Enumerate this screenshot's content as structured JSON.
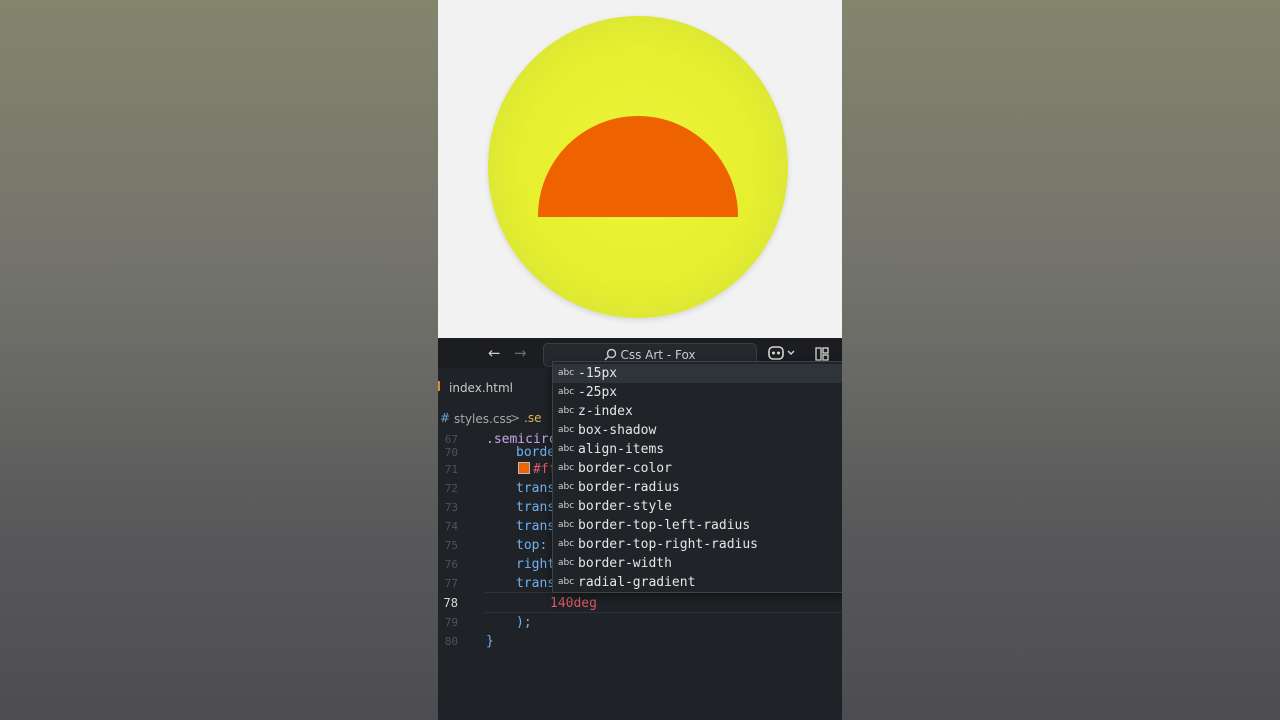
{
  "preview": {
    "colors": {
      "background": "#f2f2f2",
      "sun": "#e6f02e",
      "semicircle": "#ee6300"
    }
  },
  "titlebar": {
    "back_icon": "arrow-left-icon",
    "forward_icon": "arrow-right-icon",
    "search_text": "Css Art - Fox",
    "copilot_icon": "copilot-icon",
    "layout_icon": "layout-icon"
  },
  "tab": {
    "label": "index.html"
  },
  "breadcrumb": {
    "hash": "#",
    "file": "styles.css",
    "separator": ">",
    "node": ".se"
  },
  "code": {
    "lines": [
      {
        "num": "67",
        "text": ".semicirc"
      },
      {
        "num": "70",
        "text": "borde"
      },
      {
        "num": "71",
        "text": "#ff"
      },
      {
        "num": "72",
        "text": "trans"
      },
      {
        "num": "73",
        "text": "trans"
      },
      {
        "num": "74",
        "text": "trans"
      },
      {
        "num": "75",
        "text": "top:"
      },
      {
        "num": "76",
        "text": "right"
      },
      {
        "num": "77",
        "text": "trans"
      },
      {
        "num": "78",
        "text": "140deg"
      },
      {
        "num": "79",
        "text": ");"
      },
      {
        "num": "80",
        "text": "}"
      }
    ]
  },
  "suggestions": {
    "kind_label": "abc",
    "items": [
      "-15px",
      "-25px",
      "z-index",
      "box-shadow",
      "align-items",
      "border-color",
      "border-radius",
      "border-style",
      "border-top-left-radius",
      "border-top-right-radius",
      "border-width",
      "radial-gradient"
    ],
    "selected_index": 0
  }
}
